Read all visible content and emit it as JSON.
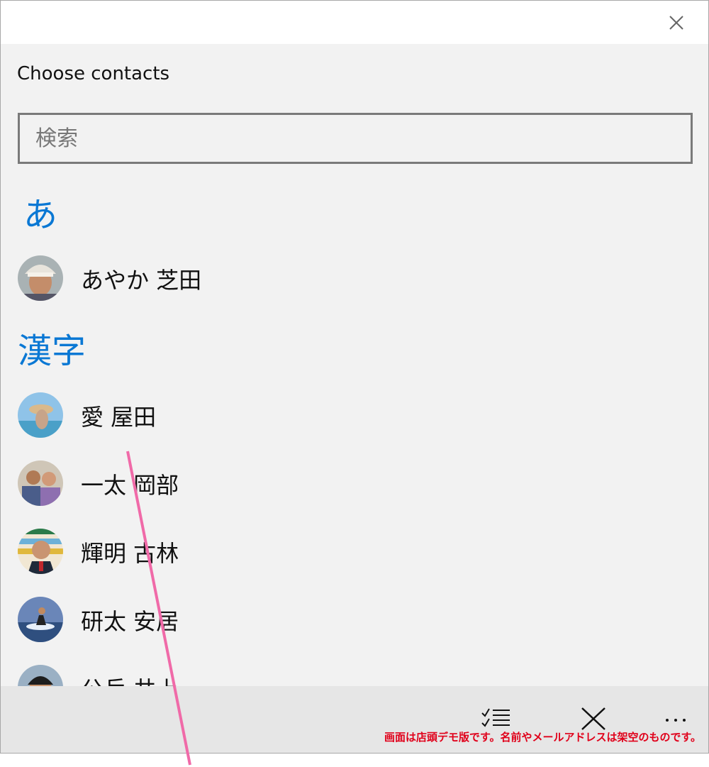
{
  "window": {
    "title": ""
  },
  "heading": "Choose contacts",
  "search": {
    "placeholder": "検索",
    "value": ""
  },
  "groups": [
    {
      "header": "あ"
    },
    {
      "header": "漢字"
    }
  ],
  "contacts": [
    {
      "name": "あやか 芝田",
      "avatar": "person-with-hat-photo"
    },
    {
      "name": "愛 屋田",
      "avatar": "person-at-beach-photo"
    },
    {
      "name": "一太 岡部",
      "avatar": "couple-photo"
    },
    {
      "name": "輝明 古林",
      "avatar": "man-in-suit-photo"
    },
    {
      "name": "研太 安居",
      "avatar": "water-ski-photo"
    },
    {
      "name": "公兵 井上",
      "avatar": "young-man-photo"
    }
  ],
  "commands": {
    "select_icon": "select-list-icon",
    "cancel_icon": "close-icon",
    "more_icon": "more-dots-icon"
  },
  "disclaimer": "画面は店頭デモ版です。名前やメールアドレスは架空のものです。",
  "colors": {
    "accent": "#0a78d4",
    "disclaimer": "#e0001a",
    "annotation_line": "#f06aa8"
  }
}
